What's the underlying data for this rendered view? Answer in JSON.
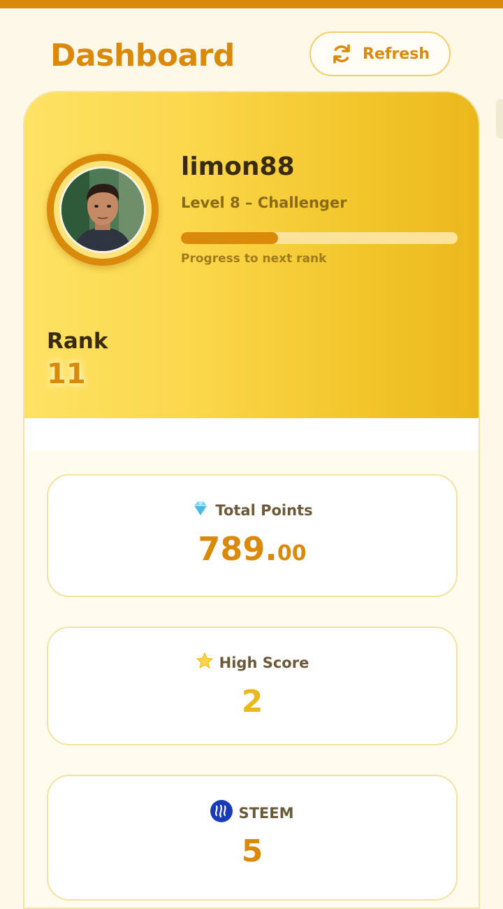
{
  "header": {
    "title": "Dashboard",
    "refresh_label": "Refresh"
  },
  "profile": {
    "username": "limon88",
    "level_text": "Level 8 – Challenger",
    "progress_fraction": 0.35,
    "progress_label": "Progress to next rank",
    "rank_label": "Rank",
    "rank_value": "11"
  },
  "stats": {
    "total_points": {
      "label": "Total Points",
      "icon": "diamond-icon",
      "value_whole": "789.",
      "value_cents": "00"
    },
    "high_score": {
      "label": "High Score",
      "icon": "star-icon",
      "value": "2"
    },
    "steem": {
      "label": "STEEM",
      "icon": "steem-logo-icon",
      "value": "5"
    }
  },
  "colors": {
    "accent": "#d98a0b",
    "gold": "#f2c52a",
    "background": "#fdf8e7"
  }
}
